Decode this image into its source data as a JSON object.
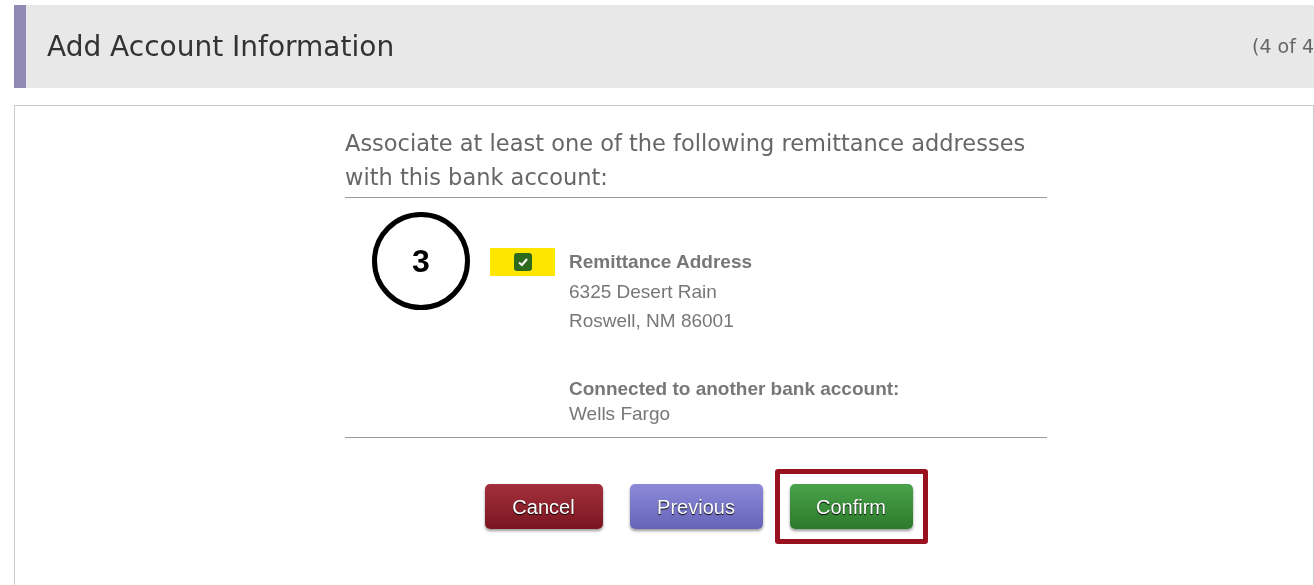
{
  "header": {
    "title": "Add Account Information",
    "step": "(4 of 4"
  },
  "prompt": "Associate at least one of the following remittance addresses with this bank account:",
  "callout": "3",
  "address": {
    "checked": true,
    "highlighted": true,
    "title": "Remittance Address",
    "lines": [
      "6325 Desert Rain",
      "Roswell, NM 86001"
    ],
    "connected_label": "Connected to another bank account:",
    "connected_bank": "Wells Fargo"
  },
  "buttons": [
    {
      "label": "Cancel",
      "kind": "cancel",
      "highlighted": false
    },
    {
      "label": "Previous",
      "kind": "previous",
      "highlighted": false
    },
    {
      "label": "Confirm",
      "kind": "confirm",
      "highlighted": true
    }
  ]
}
